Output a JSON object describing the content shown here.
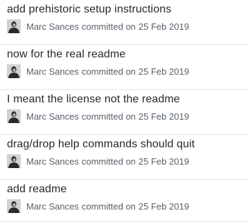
{
  "commits": [
    {
      "message": "add prehistoric setup instructions",
      "author": "Marc Sances",
      "action": "committed on",
      "date": "25 Feb 2019"
    },
    {
      "message": "now for the real readme",
      "author": "Marc Sances",
      "action": "committed on",
      "date": "25 Feb 2019"
    },
    {
      "message": "I meant the license not the readme",
      "author": "Marc Sances",
      "action": "committed on",
      "date": "25 Feb 2019"
    },
    {
      "message": "drag/drop help commands should quit",
      "author": "Marc Sances",
      "action": "committed on",
      "date": "25 Feb 2019"
    },
    {
      "message": "add readme",
      "author": "Marc Sances",
      "action": "committed on",
      "date": "25 Feb 2019"
    }
  ]
}
